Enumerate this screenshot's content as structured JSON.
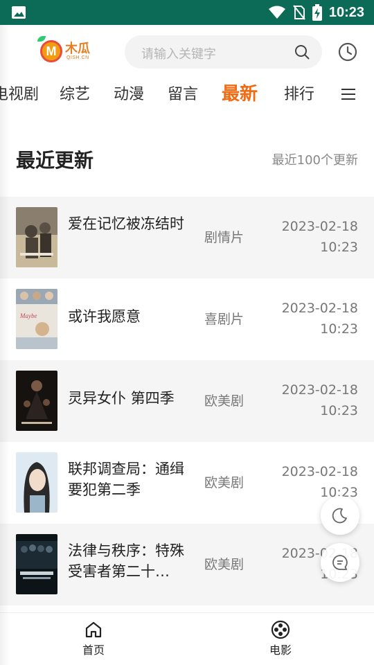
{
  "status_bar": {
    "time": "10:23"
  },
  "header": {
    "logo_text": "木瓜",
    "logo_sub": "QISH.CN",
    "search_placeholder": "请输入关键字"
  },
  "tabs": [
    {
      "label": "电视剧",
      "active": false
    },
    {
      "label": "综艺",
      "active": false
    },
    {
      "label": "动漫",
      "active": false
    },
    {
      "label": "留言",
      "active": false
    },
    {
      "label": "最新",
      "active": true
    },
    {
      "label": "排行",
      "active": false
    }
  ],
  "section": {
    "title": "最近更新",
    "subtitle": "最近100个更新"
  },
  "items": [
    {
      "title": "爱在记忆被冻结时",
      "genre": "剧情片",
      "date": "2023-02-18",
      "time": "10:23",
      "poster_colors": [
        "#8a7f6e",
        "#c9b99b",
        "#4a4238"
      ]
    },
    {
      "title": "或许我愿意",
      "genre": "喜剧片",
      "date": "2023-02-18",
      "time": "10:23",
      "poster_colors": [
        "#e9e4dc",
        "#c44a5a",
        "#9aa7b5"
      ]
    },
    {
      "title": "灵异女仆 第四季",
      "genre": "欧美剧",
      "date": "2023-02-18",
      "time": "10:23",
      "poster_colors": [
        "#2b2320",
        "#7a5a45",
        "#151210"
      ]
    },
    {
      "title": "联邦调查局：通缉要犯第二季",
      "genre": "欧美剧",
      "date": "2023-02-18",
      "time": "10:23",
      "poster_colors": [
        "#dfe9f1",
        "#2a2a2a",
        "#9cb6c9"
      ]
    },
    {
      "title": "法律与秩序：特殊受害者第二十…",
      "genre": "欧美剧",
      "date": "2023-02-18",
      "time": "10:23",
      "poster_colors": [
        "#1c2a33",
        "#445765",
        "#0d1418"
      ]
    }
  ],
  "bottom_nav": [
    {
      "label": "首页",
      "icon": "home-icon"
    },
    {
      "label": "电影",
      "icon": "film-reel-icon"
    }
  ],
  "colors": {
    "status_bar": "#0b6b57",
    "accent": "#f06b12",
    "row_shade": "#f5f5f5"
  }
}
